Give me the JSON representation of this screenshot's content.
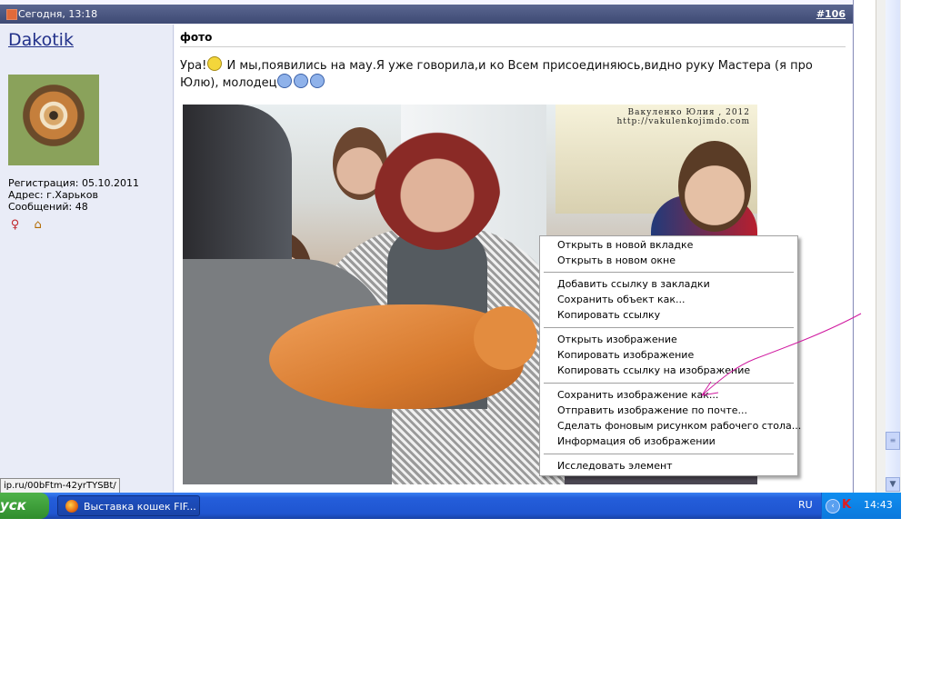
{
  "post": {
    "date": "Сегодня, 13:18",
    "number": "#106",
    "title": "фото",
    "message_part1": "Ура!",
    "message_part2": " И мы,появились на мау.Я уже говорила,и ко Всем присоединяюсь,видно руку Мастера (я про Юлю), молодец"
  },
  "user": {
    "name": "Dakotik",
    "registration": "Регистрация: 05.10.2011",
    "address": "Адрес: г.Харьков",
    "messages": "Сообщений: 48"
  },
  "photo": {
    "watermark_line1": "Вакуленко Юлия , 2012",
    "watermark_line2": "http://vakulenkojimdo.com"
  },
  "context_menu": {
    "group1": [
      "Открыть в новой вкладке",
      "Открыть в новом окне"
    ],
    "group2": [
      "Добавить ссылку в закладки",
      "Сохранить объект как...",
      "Копировать ссылку"
    ],
    "group3": [
      "Открыть изображение",
      "Копировать изображение",
      "Копировать ссылку на изображение"
    ],
    "group4": [
      "Сохранить изображение как...",
      "Отправить изображение по почте...",
      "Сделать фоновым рисунком рабочего стола...",
      "Информация об изображении"
    ],
    "group5": [
      "Исследовать элемент"
    ]
  },
  "status_url": "ip.ru/00bFtm-42yrTYSBt/",
  "taskbar": {
    "start": "уск",
    "task": "Выставка кошек FIF...",
    "lang": "RU",
    "clock": "14:43"
  },
  "colors": {
    "header": "#3e4a74",
    "username": "#22318a",
    "taskbar": "#245edb",
    "start": "#2f8d2c",
    "annotation": "#d01aa0"
  }
}
